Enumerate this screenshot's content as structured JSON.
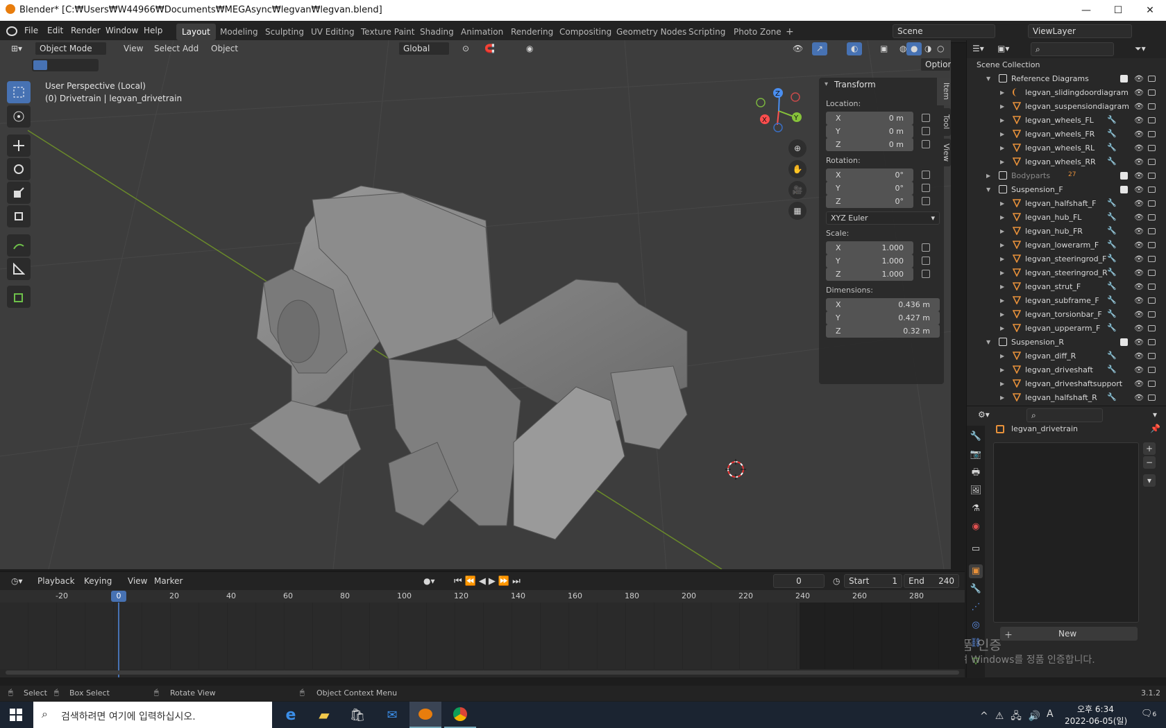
{
  "window": {
    "title": "Blender* [C:₩Users₩W44966₩Documents₩MEGAsync₩legvan₩legvan.blend]",
    "minimize": "—",
    "maximize": "☐",
    "close": "✕"
  },
  "menu": [
    "File",
    "Edit",
    "Render",
    "Window",
    "Help"
  ],
  "workspaces": [
    "Layout",
    "Modeling",
    "Sculpting",
    "UV Editing",
    "Texture Paint",
    "Shading",
    "Animation",
    "Rendering",
    "Compositing",
    "Geometry Nodes",
    "Scripting",
    "Photo Zone",
    "+"
  ],
  "scene": {
    "label": "Scene",
    "viewlayer": "ViewLayer"
  },
  "viewport": {
    "mode": "Object Mode",
    "header_menus": [
      "View",
      "Select",
      "Add",
      "Object"
    ],
    "orientation": "Global",
    "options": "Options",
    "overlay_line1": "User Perspective (Local)",
    "overlay_line2": "(0) Drivetrain | legvan_drivetrain",
    "gizmo": {
      "x": "X",
      "y": "Y",
      "z": "Z"
    }
  },
  "transform": {
    "title": "Transform",
    "location_label": "Location:",
    "location": [
      {
        "k": "X",
        "v": "0 m"
      },
      {
        "k": "Y",
        "v": "0 m"
      },
      {
        "k": "Z",
        "v": "0 m"
      }
    ],
    "rotation_label": "Rotation:",
    "rotation": [
      {
        "k": "X",
        "v": "0°"
      },
      {
        "k": "Y",
        "v": "0°"
      },
      {
        "k": "Z",
        "v": "0°"
      }
    ],
    "rotation_mode": "XYZ Euler",
    "scale_label": "Scale:",
    "scale": [
      {
        "k": "X",
        "v": "1.000"
      },
      {
        "k": "Y",
        "v": "1.000"
      },
      {
        "k": "Z",
        "v": "1.000"
      }
    ],
    "dimensions_label": "Dimensions:",
    "dimensions": [
      {
        "k": "X",
        "v": "0.436 m"
      },
      {
        "k": "Y",
        "v": "0.427 m"
      },
      {
        "k": "Z",
        "v": "0.32 m"
      }
    ],
    "side_tabs": [
      "Item",
      "Tool",
      "View"
    ]
  },
  "outliner": {
    "root": "Scene Collection",
    "rows": [
      {
        "name": "Reference Diagrams",
        "type": "collection",
        "depth": 0,
        "check": true
      },
      {
        "name": "legvan_slidingdoordiagram",
        "type": "curve",
        "depth": 1
      },
      {
        "name": "legvan_suspensiondiagram",
        "type": "mesh",
        "depth": 1
      },
      {
        "name": "legvan_wheels_FL",
        "type": "mesh",
        "depth": 1,
        "wrench": true
      },
      {
        "name": "legvan_wheels_FR",
        "type": "mesh",
        "depth": 1,
        "wrench": true
      },
      {
        "name": "legvan_wheels_RL",
        "type": "mesh",
        "depth": 1,
        "wrench": true
      },
      {
        "name": "legvan_wheels_RR",
        "type": "mesh",
        "depth": 1,
        "wrench": true
      },
      {
        "name": "Bodyparts",
        "type": "collection",
        "depth": 0,
        "collapsed": true,
        "check": true,
        "count": "27"
      },
      {
        "name": "Suspension_F",
        "type": "collection",
        "depth": 0,
        "check": true
      },
      {
        "name": "legvan_halfshaft_F",
        "type": "mesh",
        "depth": 1,
        "wrench": true
      },
      {
        "name": "legvan_hub_FL",
        "type": "mesh",
        "depth": 1,
        "wrench": true
      },
      {
        "name": "legvan_hub_FR",
        "type": "mesh",
        "depth": 1,
        "wrench": true
      },
      {
        "name": "legvan_lowerarm_F",
        "type": "mesh",
        "depth": 1,
        "wrench": true
      },
      {
        "name": "legvan_steeringrod_F",
        "type": "mesh",
        "depth": 1,
        "wrench": true
      },
      {
        "name": "legvan_steeringrod_R",
        "type": "mesh",
        "depth": 1,
        "wrench": true
      },
      {
        "name": "legvan_strut_F",
        "type": "mesh",
        "depth": 1,
        "wrench": true
      },
      {
        "name": "legvan_subframe_F",
        "type": "mesh",
        "depth": 1,
        "wrench": true
      },
      {
        "name": "legvan_torsionbar_F",
        "type": "mesh",
        "depth": 1,
        "wrench": true
      },
      {
        "name": "legvan_upperarm_F",
        "type": "mesh",
        "depth": 1,
        "wrench": true
      },
      {
        "name": "Suspension_R",
        "type": "collection",
        "depth": 0,
        "check": true
      },
      {
        "name": "legvan_diff_R",
        "type": "mesh",
        "depth": 1,
        "wrench": true
      },
      {
        "name": "legvan_driveshaft",
        "type": "mesh",
        "depth": 1,
        "wrench": true
      },
      {
        "name": "legvan_driveshaftsupport",
        "type": "mesh",
        "depth": 1
      },
      {
        "name": "legvan_halfshaft_R",
        "type": "mesh",
        "depth": 1,
        "wrench": true
      }
    ]
  },
  "properties": {
    "object_name": "legvan_drivetrain",
    "new_label": "New"
  },
  "timeline": {
    "menus": [
      "Playback",
      "Keying",
      "View",
      "Marker"
    ],
    "current_frame": "0",
    "start_label": "Start",
    "start": "1",
    "end_label": "End",
    "end": "240",
    "ticks": [
      "-20",
      "0",
      "20",
      "40",
      "60",
      "80",
      "100",
      "120",
      "140",
      "160",
      "180",
      "200",
      "220",
      "240",
      "260",
      "280"
    ]
  },
  "status": {
    "items": [
      "Select",
      "Box Select",
      "Rotate View",
      "Object Context Menu"
    ],
    "version": "3.1.2"
  },
  "watermark": {
    "line1": "Windows 정품 인증",
    "line2": "[설정]으로 이동하여 Windows를 정품 인증합니다."
  },
  "taskbar": {
    "search_placeholder": "검색하려면 여기에 입력하십시오.",
    "time": "오후 6:34",
    "date": "2022-06-05(일)",
    "lang": "A",
    "notif": "6"
  },
  "colors": {
    "accent": "#4772b3",
    "mesh_orange": "#e8913a",
    "wrench_blue": "#5d8fe8",
    "green": "#6ec14a"
  }
}
